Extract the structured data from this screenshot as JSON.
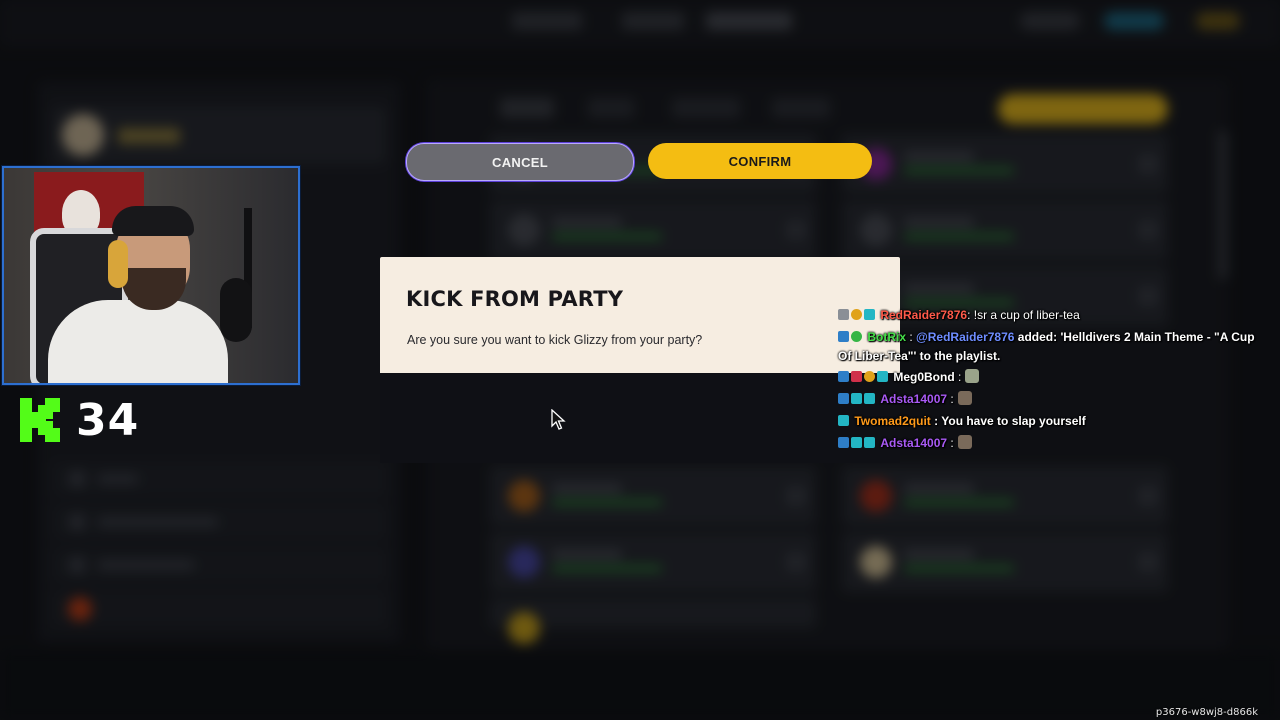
{
  "modal": {
    "title": "KICK FROM PARTY",
    "message": "Are you sure you want to kick Glizzy from your party?",
    "cancel_label": "CANCEL",
    "confirm_label": "CONFIRM"
  },
  "stream": {
    "viewer_count": "34",
    "platform_icon": "kick-logo-icon"
  },
  "chat": [
    {
      "user": "RedRaider7876",
      "user_color": "#ff5a4a",
      "badges": [
        "gray",
        "gold",
        "cyan"
      ],
      "message": ": !sr a cup of liber-tea"
    },
    {
      "user": "BotRix",
      "user_color": "#45e04a",
      "badges": [
        "blue",
        "green"
      ],
      "mention": "@RedRaider7876",
      "message": " added: 'Helldivers 2 Main Theme - \"A Cup Of Liber-Tea\"' to the playlist."
    },
    {
      "user": "Meg0Bond",
      "user_color": "#ffffff",
      "badges": [
        "blue",
        "red",
        "gold",
        "cyan"
      ],
      "message": " :",
      "emote": true
    },
    {
      "user": "Adsta14007",
      "user_color": "#a95af5",
      "badges": [
        "blue",
        "cyan",
        "cyan"
      ],
      "message": " :",
      "emote": true
    },
    {
      "user": "Twomad2quit",
      "user_color": "#ff9a1a",
      "badges": [
        "cyan"
      ],
      "message": " : You have to slap yourself"
    },
    {
      "user": "Adsta14007",
      "user_color": "#a95af5",
      "badges": [
        "blue",
        "cyan",
        "cyan"
      ],
      "message": " :",
      "emote": true
    }
  ],
  "colors": {
    "modal_top": "#f6ede1",
    "modal_bottom": "#0f1015",
    "confirm": "#f4bd12",
    "cancel": "#6a6a70",
    "kick_green": "#53fc18",
    "cam_border": "#2d6fd0"
  },
  "watermark": "p3676-w8wj8-d866k"
}
